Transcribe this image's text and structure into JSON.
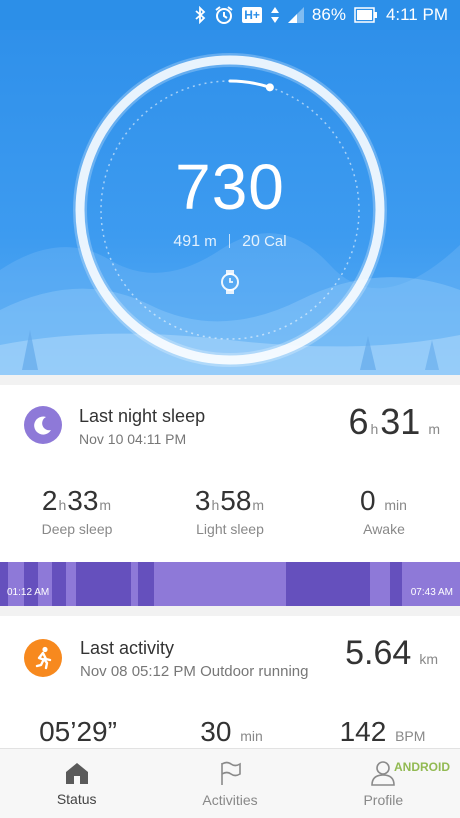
{
  "statusbar": {
    "battery": "86%",
    "time": "4:11 PM",
    "network": "H+"
  },
  "hero": {
    "steps": "730",
    "distance_value": "491",
    "distance_unit": "m",
    "calories_value": "20",
    "calories_unit": "Cal",
    "goal_progress": 0.05
  },
  "sleep": {
    "title": "Last night sleep",
    "date": "Nov 10 04:11 PM",
    "total_h": "6",
    "h_unit": "h",
    "total_m": "31",
    "m_unit": "m",
    "deep": {
      "h": "2",
      "m": "33",
      "label": "Deep sleep"
    },
    "light": {
      "h": "3",
      "m": "58",
      "label": "Light sleep"
    },
    "awake": {
      "value": "0",
      "unit": "min",
      "label": "Awake"
    },
    "start_time": "01:12 AM",
    "end_time": "07:43 AM",
    "colors": {
      "light": "#8e79d8",
      "deep": "#6550bd",
      "awake": "#a594e6"
    }
  },
  "activity": {
    "title": "Last activity",
    "subtitle": "Nov 08 05:12 PM Outdoor running",
    "distance": "5.64",
    "distance_unit": "km",
    "pace": "05’29”",
    "duration": "30",
    "duration_unit": "min",
    "heart_rate": "142",
    "heart_rate_unit": "BPM"
  },
  "nav": [
    {
      "label": "Status"
    },
    {
      "label": "Activities"
    },
    {
      "label": "Profile"
    }
  ],
  "watermark": "ANDROID",
  "colors": {
    "primary": "#2f90ea",
    "sleep_purple": "#8e79d8",
    "activity_orange": "#f7891e"
  }
}
